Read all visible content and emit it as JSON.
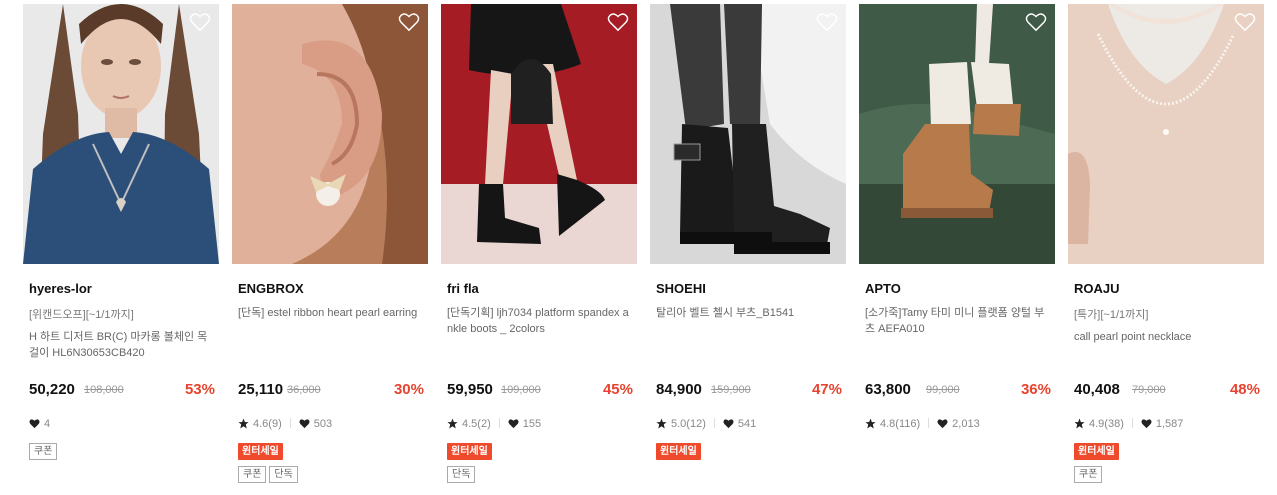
{
  "products": [
    {
      "image": "woman-heart-necklace-photo",
      "brand": "hyeres-lor",
      "tag": "[위캔드오프][~1/1까지]",
      "title": "H 하트 디저트 BR(C) 마카롱 볼체인 목걸이 HL6N30653CB420",
      "price": "50,220",
      "original_price": "108,000",
      "discount": "53%",
      "rating": "",
      "likes": "4",
      "red_badge": "",
      "outline_badges": [
        "쿠폰"
      ]
    },
    {
      "image": "ear-pearl-ribbon-earring-photo",
      "brand": "ENGBROX",
      "tag": "",
      "title": "[단독] estel ribbon heart pearl earring",
      "price": "25,110",
      "original_price": "36,000",
      "discount": "30%",
      "rating": "4.6(9)",
      "likes": "503",
      "red_badge": "윈터세일",
      "outline_badges": [
        "쿠폰",
        "단독"
      ]
    },
    {
      "image": "ankle-boots-bag-photo",
      "brand": "fri fla",
      "tag": "",
      "title": "[단독기획] ljh7034 platform spandex ankle boots _ 2colors",
      "price": "59,950",
      "original_price": "109,000",
      "discount": "45%",
      "rating": "4.5(2)",
      "likes": "155",
      "red_badge": "윈터세일",
      "outline_badges": [
        "단독"
      ]
    },
    {
      "image": "chelsea-boots-photo",
      "brand": "SHOEHI",
      "tag": "",
      "title": "탈리아 벨트 첼시 부츠_B1541",
      "price": "84,900",
      "original_price": "159,900",
      "discount": "47%",
      "rating": "5.0(12)",
      "likes": "541",
      "red_badge": "윈터세일",
      "outline_badges": []
    },
    {
      "image": "platform-sheepskin-boots-photo",
      "brand": "APTO",
      "tag": "",
      "title": "[소가죽]Tamy 타미 미니 플랫폼 양털 부츠 AEFA010",
      "price": "63,800",
      "original_price": "99,000",
      "discount": "36%",
      "rating": "4.8(116)",
      "likes": "2,013",
      "red_badge": "",
      "outline_badges": []
    },
    {
      "image": "pearl-necklace-photo",
      "brand": "ROAJU",
      "tag": "[특가][~1/1까지]",
      "title": "call pearl point necklace",
      "price": "40,408",
      "original_price": "79,000",
      "discount": "48%",
      "rating": "4.9(38)",
      "likes": "1,587",
      "red_badge": "윈터세일",
      "outline_badges": [
        "쿠폰"
      ]
    }
  ],
  "icons": {
    "wishlist": "heart-outline-icon",
    "rating": "star-icon",
    "likes": "heart-filled-icon"
  },
  "colors": {
    "discount": "#e8432e",
    "sale_badge": "#ef4a2b"
  }
}
